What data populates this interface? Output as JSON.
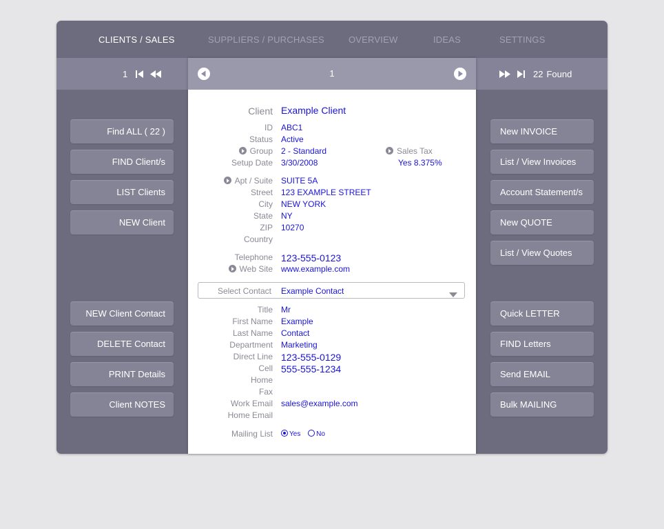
{
  "tabs": [
    {
      "label": "CLIENTS / SALES"
    },
    {
      "label": "SUPPLIERS / PURCHASES"
    },
    {
      "label": "OVERVIEW"
    },
    {
      "label": "IDEAS"
    },
    {
      "label": "SETTINGS"
    }
  ],
  "nav": {
    "first_record": "1",
    "current_record": "1",
    "found_count": "22",
    "found_label": "Found"
  },
  "left_buttons": [
    "Find ALL  ( 22 )",
    "FIND Client/s",
    "LIST Clients",
    "NEW Client",
    "NEW Client Contact",
    "DELETE Contact",
    "PRINT Details",
    "Client NOTES"
  ],
  "right_buttons": [
    "New INVOICE",
    "List / View Invoices",
    "Account Statement/s",
    "New QUOTE",
    "List / View Quotes",
    "Quick LETTER",
    "FIND Letters",
    "Send EMAIL",
    "Bulk MAILING"
  ],
  "client": {
    "client_label": "Client",
    "client": "Example Client",
    "id_label": "ID",
    "id": "ABC1",
    "status_label": "Status",
    "status": "Active",
    "group_label": "Group",
    "group": "2 - Standard",
    "setup_label": "Setup Date",
    "setup_date": "3/30/2008",
    "sales_tax_label": "Sales Tax",
    "sales_tax": "Yes  8.375%",
    "apt_label": "Apt / Suite",
    "apt": "SUITE 5A",
    "street_label": "Street",
    "street": "123 EXAMPLE STREET",
    "city_label": "City",
    "city": "NEW YORK",
    "state_label": "State",
    "state": "NY",
    "zip_label": "ZIP",
    "zip": "10270",
    "country_label": "Country",
    "country": "",
    "telephone_label": "Telephone",
    "telephone": "123-555-0123",
    "website_label": "Web Site",
    "website": "www.example.com"
  },
  "contact": {
    "select_label": "Select Contact",
    "selected": "Example Contact",
    "title_label": "Title",
    "title": "Mr",
    "first_label": "First Name",
    "first_name": "Example",
    "last_label": "Last Name",
    "last_name": "Contact",
    "dept_label": "Department",
    "department": "Marketing",
    "direct_label": "Direct Line",
    "direct_line": "123-555-0129",
    "cell_label": "Cell",
    "cell": "555-555-1234",
    "home_label": "Home",
    "home": "",
    "fax_label": "Fax",
    "fax": "",
    "work_email_label": "Work Email",
    "work_email": "sales@example.com",
    "home_email_label": "Home Email",
    "home_email": "",
    "mailing_label": "Mailing List",
    "mailing_yes": "Yes",
    "mailing_no": "No",
    "mailing_selected": "Yes"
  },
  "colors": {
    "frame": "#6d6c7e",
    "navbar": "#848398",
    "button": "#858497",
    "value_text": "#1a14d8",
    "label_text": "#8a8a96"
  }
}
